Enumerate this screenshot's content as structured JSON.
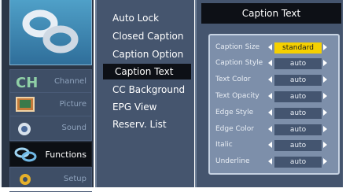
{
  "left_menu": {
    "items": [
      {
        "label": "Channel",
        "icon": "satellite-dish-icon"
      },
      {
        "label": "Picture",
        "icon": "picture-icon"
      },
      {
        "label": "Sound",
        "icon": "sound-icon"
      },
      {
        "label": "Functions",
        "icon": "functions-icon",
        "active": true
      },
      {
        "label": "Setup",
        "icon": "setup-gear-icon"
      }
    ],
    "logo": "linked-rings-logo",
    "badge": "CH"
  },
  "mid_menu": {
    "items": [
      {
        "label": "Auto Lock"
      },
      {
        "label": "Closed Caption"
      },
      {
        "label": "Caption Option"
      },
      {
        "label": "Caption Text",
        "selected": true
      },
      {
        "label": "CC Background"
      },
      {
        "label": "EPG View"
      },
      {
        "label": "Reserv. List"
      }
    ]
  },
  "right_panel": {
    "title": "Caption Text",
    "rows": [
      {
        "label": "Caption Size",
        "value": "standard"
      },
      {
        "label": "Caption Style",
        "value": "auto"
      },
      {
        "label": "Text Color",
        "value": "auto"
      },
      {
        "label": "Text Opacity",
        "value": "auto"
      },
      {
        "label": "Edge Style",
        "value": "auto"
      },
      {
        "label": "Edge Color",
        "value": "auto"
      },
      {
        "label": "Italic",
        "value": "auto"
      },
      {
        "label": "Underline",
        "value": "auto"
      }
    ]
  },
  "colors": {
    "highlight": "#f5d000",
    "panel": "#45556e",
    "selected_bg": "#0d1016"
  }
}
